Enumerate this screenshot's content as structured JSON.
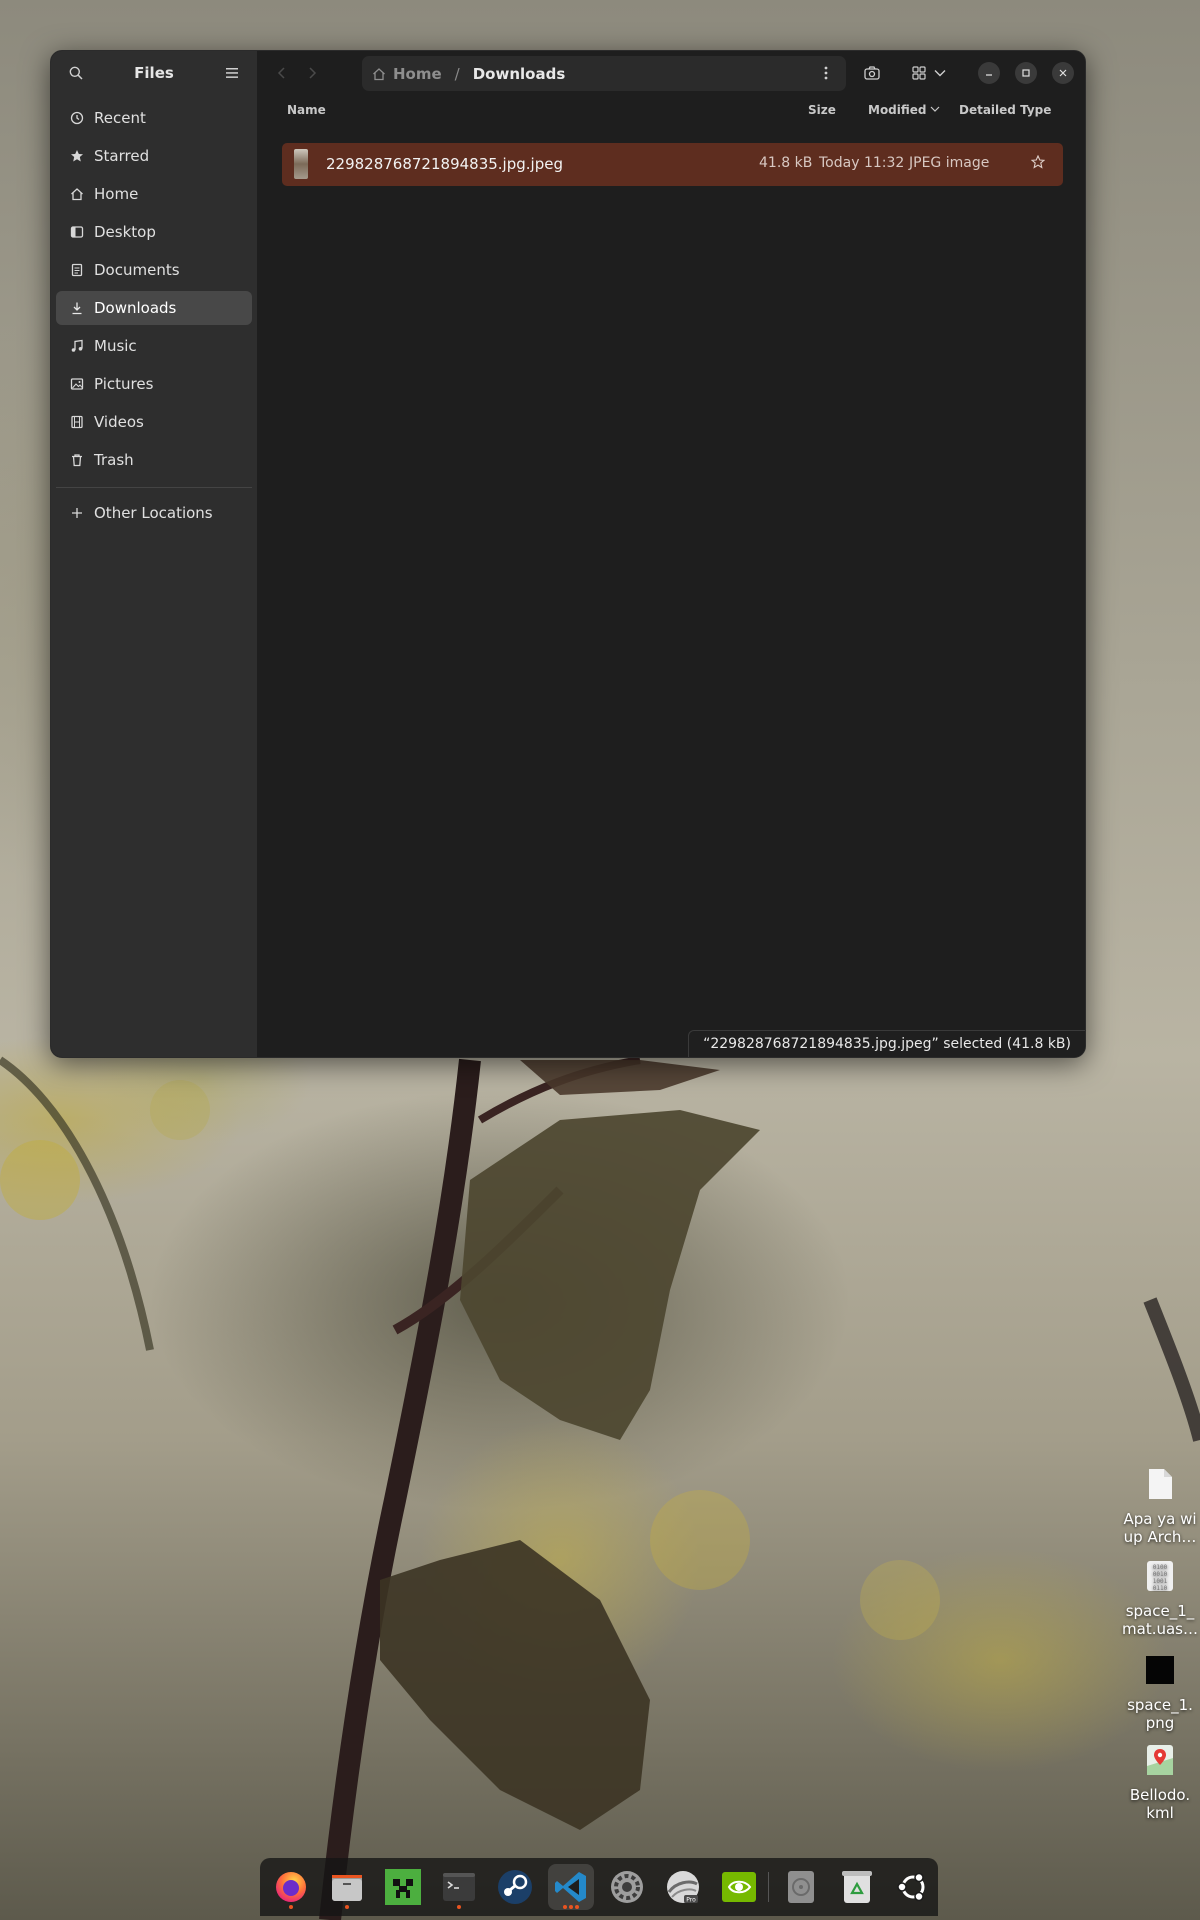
{
  "sidebar": {
    "title": "Files",
    "items": [
      {
        "label": "Recent",
        "icon": "clock-icon"
      },
      {
        "label": "Starred",
        "icon": "star-icon"
      },
      {
        "label": "Home",
        "icon": "home-icon"
      },
      {
        "label": "Desktop",
        "icon": "desktop-icon"
      },
      {
        "label": "Documents",
        "icon": "document-icon"
      },
      {
        "label": "Downloads",
        "icon": "download-icon",
        "active": true
      },
      {
        "label": "Music",
        "icon": "music-icon"
      },
      {
        "label": "Pictures",
        "icon": "picture-icon"
      },
      {
        "label": "Videos",
        "icon": "film-icon"
      },
      {
        "label": "Trash",
        "icon": "trash-icon"
      }
    ],
    "other_locations": "Other Locations"
  },
  "pathbar": {
    "home": "Home",
    "separator": "/",
    "current": "Downloads"
  },
  "columns": {
    "name": "Name",
    "size": "Size",
    "modified": "Modified",
    "type": "Detailed Type"
  },
  "files": [
    {
      "name": "229828768721894835.jpg.jpeg",
      "size": "41.8 kB",
      "modified": "Today 11:32",
      "type": "JPEG image",
      "selected": true
    }
  ],
  "status": "“229828768721894835.jpg.jpeg” selected  (41.8 kB)",
  "desktop_icons": [
    {
      "label": "Apa ya wi up Arch…",
      "icon": "text-file-icon"
    },
    {
      "label": "space_1_ mat.uas…",
      "icon": "binary-file-icon"
    },
    {
      "label": "space_1. png",
      "icon": "image-file-icon"
    },
    {
      "label": "Bellodo. kml",
      "icon": "map-file-icon"
    }
  ],
  "dock": [
    {
      "name": "firefox",
      "running": true
    },
    {
      "name": "files",
      "running": true
    },
    {
      "name": "minecraft",
      "running": false
    },
    {
      "name": "terminal",
      "running": true
    },
    {
      "name": "steam",
      "running": false
    },
    {
      "name": "vscode",
      "running": true,
      "active": true
    },
    {
      "name": "settings",
      "running": false
    },
    {
      "name": "google-earth-pro",
      "running": false
    },
    {
      "name": "nvidia-settings",
      "running": false
    },
    {
      "name": "disk",
      "running": false
    },
    {
      "name": "trash",
      "running": false
    },
    {
      "name": "ubuntu-apps",
      "running": false
    }
  ],
  "colors": {
    "selection": "#5e2d1f",
    "sidebar_bg": "#2e2e2e",
    "window_bg": "#1e1e1e",
    "accent": "#e95420"
  }
}
